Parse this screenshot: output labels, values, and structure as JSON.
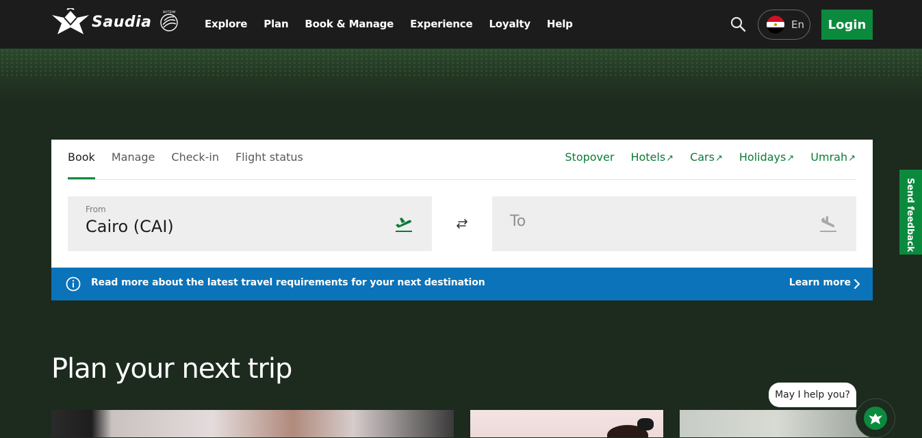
{
  "brand": {
    "name": "Saudia",
    "alliance": "SKYTEAM"
  },
  "nav": {
    "items": [
      "Explore",
      "Plan",
      "Book & Manage",
      "Experience",
      "Loyalty",
      "Help"
    ]
  },
  "header": {
    "language": "En",
    "login_label": "Login"
  },
  "booking": {
    "tabs": [
      "Book",
      "Manage",
      "Check-in",
      "Flight status"
    ],
    "active_tab": "Book",
    "links": [
      "Stopover",
      "Hotels",
      "Cars",
      "Holidays",
      "Umrah"
    ],
    "external_arrow": "↗",
    "from": {
      "label": "From",
      "value": "Cairo (CAI)"
    },
    "to": {
      "placeholder": "To"
    }
  },
  "banner": {
    "text": "Read more about the latest travel requirements for your next destination",
    "link_label": "Learn more"
  },
  "feedback": {
    "label": "Send feedback"
  },
  "plan": {
    "title": "Plan your next trip"
  },
  "chat": {
    "prompt": "May I help you?"
  },
  "colors": {
    "brand_green": "#0b8a3e",
    "header_bg": "#1c1c1c",
    "page_bg": "#1d2a1e",
    "banner_blue": "#0a73b9"
  }
}
